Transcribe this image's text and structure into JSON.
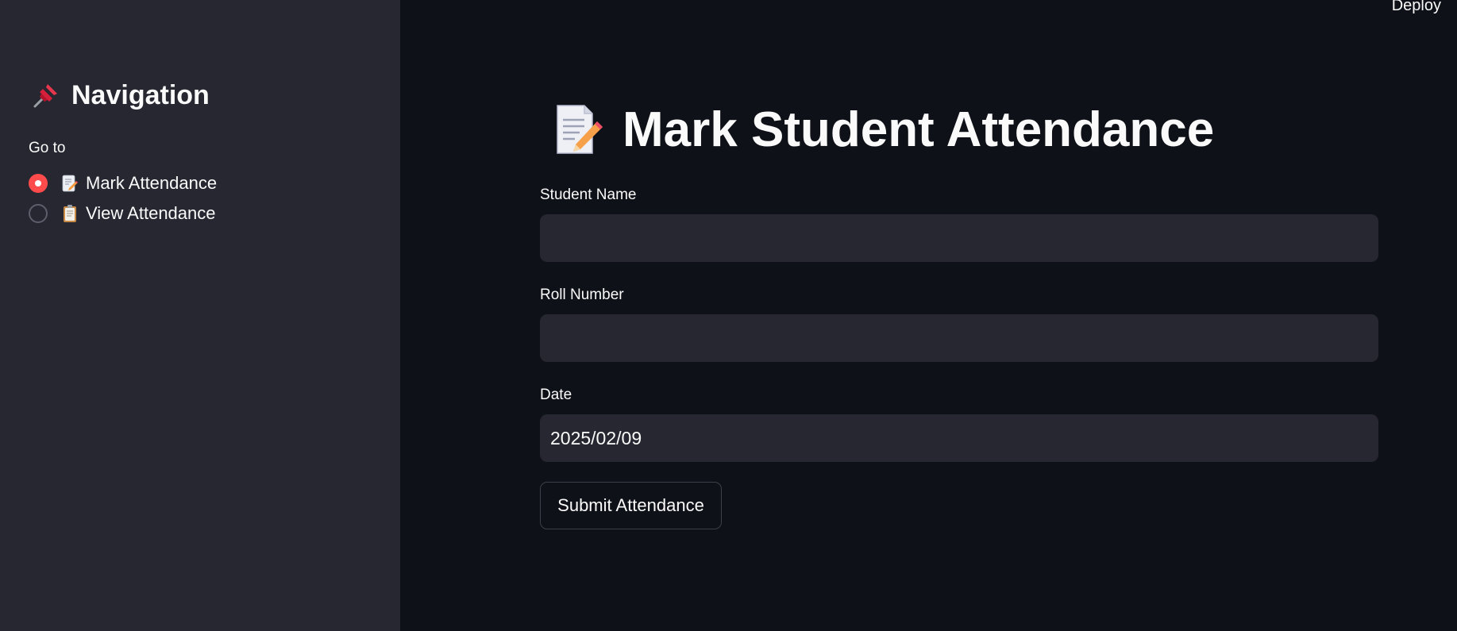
{
  "header": {
    "deploy_label": "Deploy"
  },
  "sidebar": {
    "title": "Navigation",
    "title_icon": "pushpin-icon",
    "radio_group_label": "Go to",
    "items": [
      {
        "label": "Mark Attendance",
        "icon": "memo-icon",
        "selected": true
      },
      {
        "label": "View Attendance",
        "icon": "clipboard-icon",
        "selected": false
      }
    ]
  },
  "main": {
    "title": "Mark Student Attendance",
    "title_icon": "memo-icon",
    "fields": [
      {
        "label": "Student Name",
        "value": "",
        "placeholder": ""
      },
      {
        "label": "Roll Number",
        "value": "",
        "placeholder": ""
      },
      {
        "label": "Date",
        "value": "2025/02/09",
        "placeholder": ""
      }
    ],
    "submit_label": "Submit Attendance"
  },
  "colors": {
    "app_background": "#0e1117",
    "sidebar_background": "#262730",
    "input_background": "#262730",
    "accent": "#ff4b4b",
    "text": "#fafafa"
  }
}
